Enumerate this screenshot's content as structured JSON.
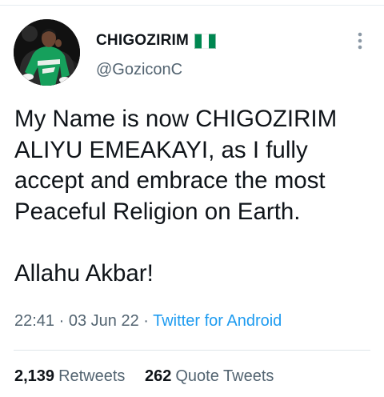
{
  "user": {
    "display_name": "CHIGOZIRIM",
    "handle": "@GoziconC",
    "flag_icon": "nigeria-flag-icon",
    "avatar_icon": "profile-photo"
  },
  "tweet": {
    "lines": [
      "My Name is now CHIGOZIRIM",
      "ALIYU EMEAKAYI, as I fully",
      "accept and embrace the most",
      "Peaceful Religion on Earth.",
      "Allahu Akbar!"
    ]
  },
  "meta": {
    "time": "22:41",
    "date": "03 Jun 22",
    "separator": " · ",
    "source": "Twitter for Android"
  },
  "stats": {
    "retweets_count": "2,139",
    "retweets_label": "Retweets",
    "quotes_count": "262",
    "quotes_label": "Quote Tweets"
  },
  "colors": {
    "text_primary": "#0f1419",
    "text_secondary": "#536471",
    "link": "#1d9bf0",
    "flag_green": "#008751"
  },
  "more_icon": "more-vertical-icon"
}
